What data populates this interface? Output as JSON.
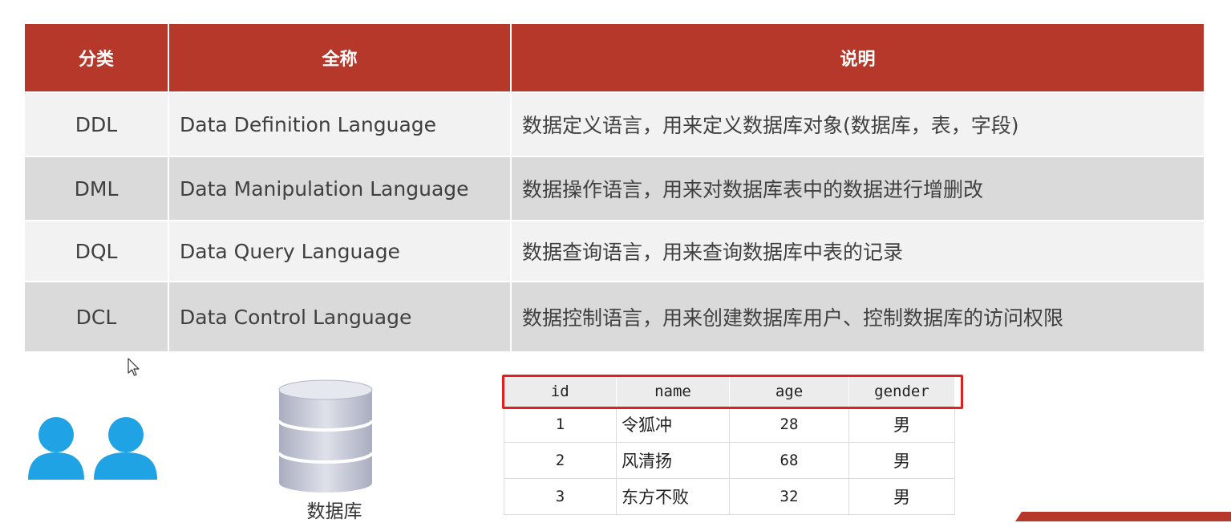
{
  "sql_categories": {
    "headers": [
      "分类",
      "全称",
      "说明"
    ],
    "rows": [
      {
        "category": "DDL",
        "full_name": "Data Definition Language",
        "description": "数据定义语言，用来定义数据库对象(数据库，表，字段)"
      },
      {
        "category": "DML",
        "full_name": "Data Manipulation Language",
        "description": "数据操作语言，用来对数据库表中的数据进行增删改"
      },
      {
        "category": "DQL",
        "full_name": "Data Query Language",
        "description": "数据查询语言，用来查询数据库中表的记录"
      },
      {
        "category": "DCL",
        "full_name": "Data Control Language",
        "description": "数据控制语言，用来创建数据库用户、控制数据库的访问权限"
      }
    ]
  },
  "diagram": {
    "users_icon": "users-icon",
    "database_icon": "database-icon",
    "database_label": "数据库"
  },
  "sample_table": {
    "headers": [
      "id",
      "name",
      "age",
      "gender"
    ],
    "rows": [
      {
        "id": "1",
        "name": "令狐冲",
        "age": "28",
        "gender": "男"
      },
      {
        "id": "2",
        "name": "风清扬",
        "age": "68",
        "gender": "男"
      },
      {
        "id": "3",
        "name": "东方不败",
        "age": "32",
        "gender": "男"
      }
    ]
  },
  "colors": {
    "header_red": "#b5382a",
    "highlight_red": "#e02020",
    "user_blue": "#1fa3e5",
    "db_gray": "#c7cad6"
  }
}
